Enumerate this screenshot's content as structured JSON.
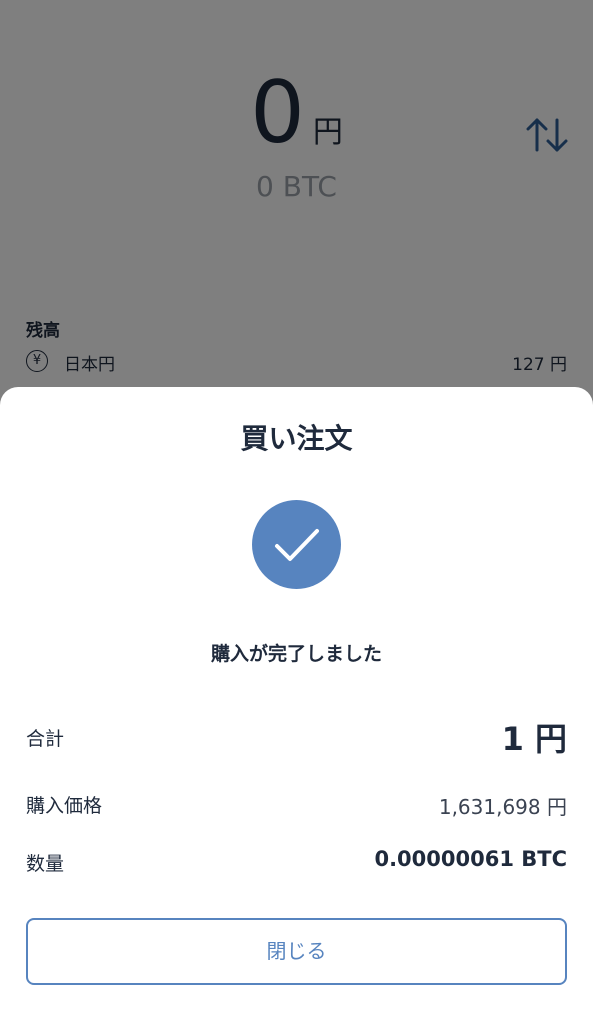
{
  "balance_header": {
    "fiat_amount": "0",
    "fiat_unit": "円",
    "btc_amount": "0 BTC",
    "swap_icon": "swap-vertical-arrows-icon",
    "text_color": "#1f2a3c",
    "subtext_color": "#9aa0a8"
  },
  "balance_section": {
    "label": "残高",
    "currencies": [
      {
        "icon": "yen-circle-icon",
        "icon_symbol": "¥",
        "name": "日本円",
        "balance": "127 円"
      }
    ]
  },
  "order_sheet": {
    "title": "買い注文",
    "status_icon": "checkmark-circle-icon",
    "accent_color": "#5784bf",
    "message": "購入が完了しました",
    "details": {
      "total_label": "合計",
      "total_value": "1 円",
      "price_label": "購入価格",
      "price_value": "1,631,698 円",
      "quantity_label": "数量",
      "quantity_value": "0.00000061 BTC"
    },
    "close_label": "閉じる"
  }
}
